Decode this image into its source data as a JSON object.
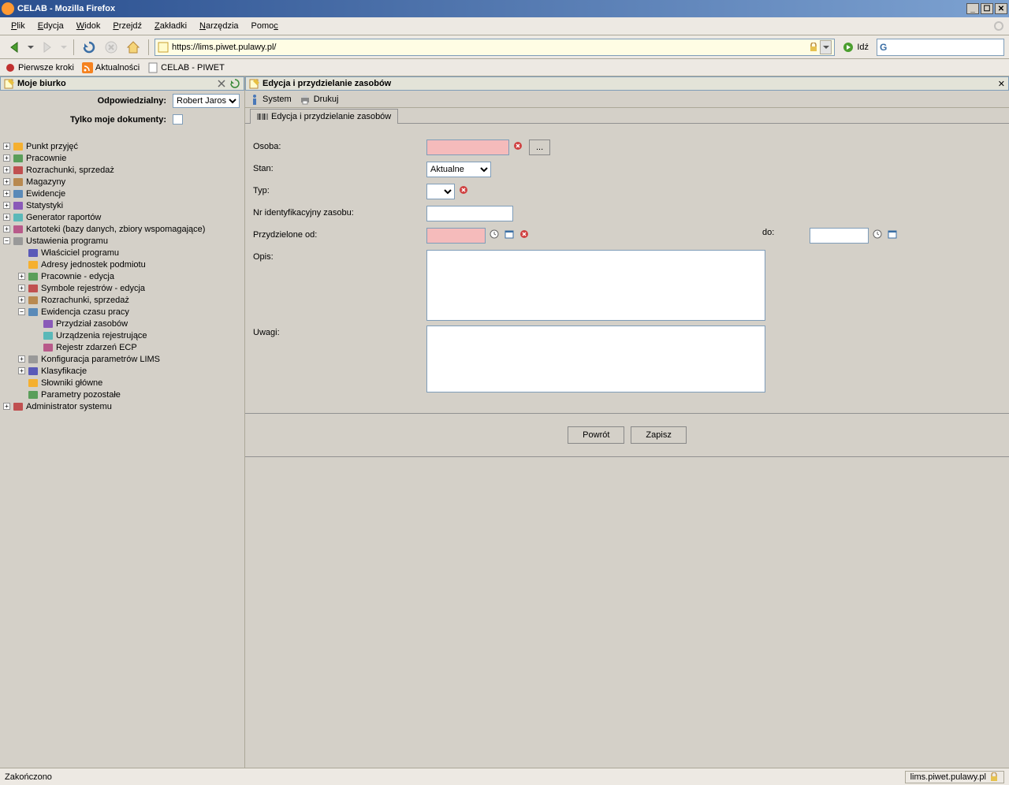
{
  "window": {
    "title": "CELAB - Mozilla Firefox"
  },
  "menu": {
    "items": [
      "Plik",
      "Edycja",
      "Widok",
      "Przejdź",
      "Zakładki",
      "Narzędzia",
      "Pomoc"
    ]
  },
  "url": "https://lims.piwet.pulawy.pl/",
  "go_label": "Idź",
  "bookmarks": [
    {
      "label": "Pierwsze kroki",
      "icon": "star-red"
    },
    {
      "label": "Aktualności",
      "icon": "rss"
    },
    {
      "label": "CELAB - PIWET",
      "icon": "page"
    }
  ],
  "sidebar": {
    "title": "Moje biurko",
    "filter_label": "Odpowiedzialny:",
    "filter_value": "Robert Jaros",
    "docs_label": "Tylko moje dokumenty:",
    "tree": [
      {
        "ind": 1,
        "exp": "+",
        "label": "Punkt przyjęć"
      },
      {
        "ind": 1,
        "exp": "+",
        "label": "Pracownie"
      },
      {
        "ind": 1,
        "exp": "+",
        "label": "Rozrachunki, sprzedaż"
      },
      {
        "ind": 1,
        "exp": "+",
        "label": "Magazyny"
      },
      {
        "ind": 1,
        "exp": "+",
        "label": "Ewidencje"
      },
      {
        "ind": 1,
        "exp": "+",
        "label": "Statystyki"
      },
      {
        "ind": 1,
        "exp": "+",
        "label": "Generator raportów"
      },
      {
        "ind": 1,
        "exp": "+",
        "label": "Kartoteki (bazy danych, zbiory wspomagające)"
      },
      {
        "ind": 1,
        "exp": "−",
        "label": "Ustawienia programu"
      },
      {
        "ind": 2,
        "exp": " ",
        "label": "Właściciel programu"
      },
      {
        "ind": 2,
        "exp": " ",
        "label": "Adresy jednostek podmiotu"
      },
      {
        "ind": 2,
        "exp": "+",
        "label": "Pracownie - edycja"
      },
      {
        "ind": 2,
        "exp": "+",
        "label": "Symbole rejestrów - edycja"
      },
      {
        "ind": 2,
        "exp": "+",
        "label": "Rozrachunki, sprzedaż"
      },
      {
        "ind": 2,
        "exp": "−",
        "label": "Ewidencja czasu pracy"
      },
      {
        "ind": 3,
        "exp": " ",
        "label": "Przydział zasobów"
      },
      {
        "ind": 3,
        "exp": " ",
        "label": "Urządzenia rejestrujące"
      },
      {
        "ind": 3,
        "exp": " ",
        "label": "Rejestr zdarzeń ECP"
      },
      {
        "ind": 2,
        "exp": "+",
        "label": "Konfiguracja parametrów LIMS"
      },
      {
        "ind": 2,
        "exp": "+",
        "label": "Klasyfikacje"
      },
      {
        "ind": 2,
        "exp": " ",
        "label": "Słowniki główne"
      },
      {
        "ind": 2,
        "exp": " ",
        "label": "Parametry pozostałe"
      },
      {
        "ind": 1,
        "exp": "+",
        "label": "Administrator systemu"
      }
    ]
  },
  "content": {
    "title": "Edycja i przydzielanie zasobów",
    "actions": [
      {
        "label": "System",
        "icon": "info"
      },
      {
        "label": "Drukuj",
        "icon": "print"
      }
    ],
    "tab": "Edycja i przydzielanie zasobów",
    "form": {
      "osoba_label": "Osoba:",
      "stan_label": "Stan:",
      "stan_value": "Aktualne",
      "typ_label": "Typ:",
      "nr_label": "Nr identyfikacyjny zasobu:",
      "od_label": "Przydzielone od:",
      "do_label": "do:",
      "opis_label": "Opis:",
      "uwagi_label": "Uwagi:"
    },
    "buttons": {
      "back": "Powrót",
      "save": "Zapisz"
    }
  },
  "status": {
    "text": "Zakończono",
    "domain": "lims.piwet.pulawy.pl"
  }
}
